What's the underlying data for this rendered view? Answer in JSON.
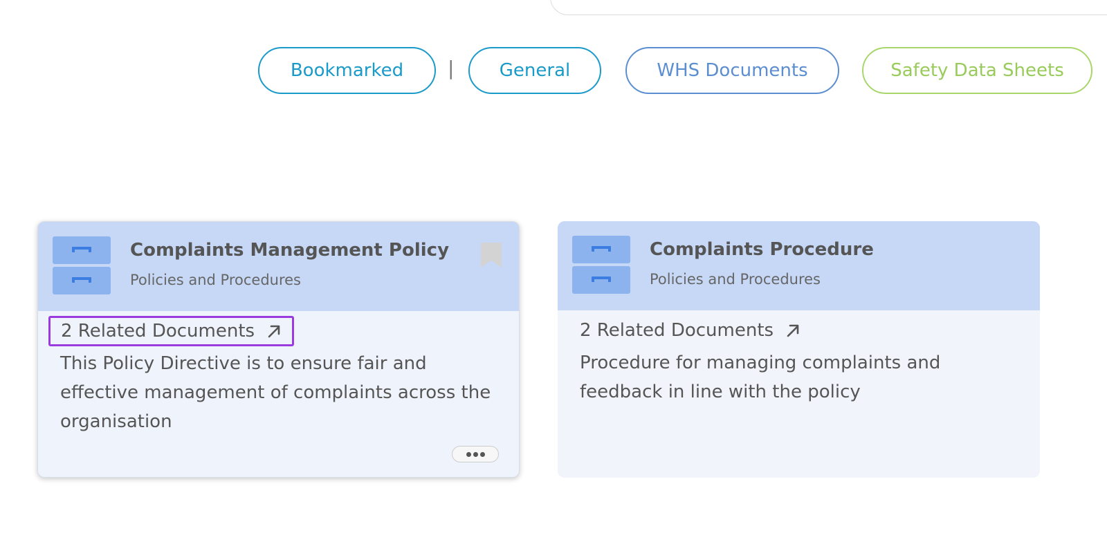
{
  "filters": {
    "bookmarked": "Bookmarked",
    "separator": "|",
    "general": "General",
    "whs": "WHS Documents",
    "sds": "Safety Data Sheets"
  },
  "cards": [
    {
      "title": "Complaints Management Policy",
      "category": "Policies and Procedures",
      "related": "2 Related Documents",
      "description": "This Policy Directive is to ensure fair and effective management of complaints across the organisation"
    },
    {
      "title": "Complaints Procedure",
      "category": "Policies and Procedures",
      "related": "2 Related Documents",
      "description": "Procedure for managing complaints and feedback in line with the policy"
    }
  ],
  "colors": {
    "card_header": "#c6d8f6",
    "card_body": "#eff3fb",
    "filter_general": "#1a9ac9",
    "filter_whs": "#5b8ed0",
    "filter_sds": "#a8d66b",
    "highlight": "#9a3be0"
  },
  "icons": [
    "filing-cabinet-icon",
    "bookmark-icon",
    "external-arrow-icon",
    "more-icon"
  ]
}
